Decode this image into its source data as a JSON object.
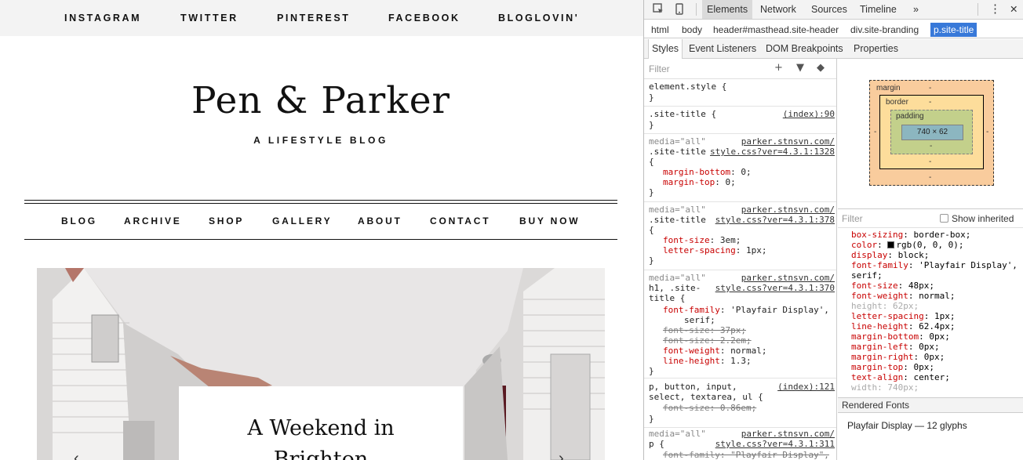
{
  "site": {
    "social": [
      "INSTAGRAM",
      "TWITTER",
      "PINTEREST",
      "FACEBOOK",
      "BLOGLOVIN'"
    ],
    "title": "Pen & Parker",
    "tagline": "A LIFESTYLE BLOG",
    "nav": [
      "BLOG",
      "ARCHIVE",
      "SHOP",
      "GALLERY",
      "ABOUT",
      "CONTACT",
      "BUY NOW"
    ],
    "featured_post": {
      "title_line1": "A Weekend in",
      "title_line2": "Brighton"
    },
    "slider": {
      "prev": "‹",
      "next": "›"
    }
  },
  "devtools": {
    "toolbar": {
      "inspect_icon": "inspect-icon",
      "device_icon": "device-icon",
      "more": "»",
      "menu": "⋮",
      "close": "✕"
    },
    "tabs": [
      "Elements",
      "Network",
      "Sources",
      "Timeline"
    ],
    "active_tab": "Elements",
    "breadcrumbs": [
      "html",
      "body",
      "header#masthead.site-header",
      "div.site-branding",
      "p.site-title"
    ],
    "subtabs": [
      "Styles",
      "Event Listeners",
      "DOM Breakpoints",
      "Properties"
    ],
    "styles_filter_placeholder": "Filter",
    "style_rules": {
      "r0": {
        "l1": "element.style {",
        "l2": "}"
      },
      "r1": {
        "selector": ".site-title {",
        "src": "(index):90",
        "close": "}"
      },
      "r2": {
        "media": "media=\"all\"",
        "src_a": "parker.stnsvn.com/",
        "selector": ".site-title",
        "src_b": "style.css?ver=4.3.1:1328",
        "open": "{",
        "p1n": "margin-bottom",
        "p1v": ": 0;",
        "p2n": "margin-top",
        "p2v": ": 0;",
        "close": "}"
      },
      "r3": {
        "media": "media=\"all\"",
        "src_a": "parker.stnsvn.com/",
        "selector": ".site-title",
        "src_b": "style.css?ver=4.3.1:378",
        "open": "{",
        "p1n": "font-size",
        "p1v": ": 3em;",
        "p2n": "letter-spacing",
        "p2v": ": 1px;",
        "close": "}"
      },
      "r4": {
        "media": "media=\"all\"",
        "src_a": "parker.stnsvn.com/",
        "sel1": "h1, .site-",
        "src_b": "style.css?ver=4.3.1:370",
        "sel2": "title {",
        "p1n": "font-family",
        "p1v": ": 'Playfair Display',",
        "p1v2": "serif;",
        "p2n": "font-size",
        "p2v": ": 37px;",
        "p3n": "font-size",
        "p3v": ": 2.2em;",
        "p4n": "font-weight",
        "p4v": ": normal;",
        "p5n": "line-height",
        "p5v": ": 1.3;",
        "close": "}"
      },
      "r5": {
        "sel1": "p, button, input,",
        "src": "(index):121",
        "sel2": "select, textarea, ul {",
        "p1n": "font-size",
        "p1v": ": 0.86em;",
        "close": "}"
      },
      "r6": {
        "media": "media=\"all\"",
        "src_a": "parker.stnsvn.com/",
        "sel": "p {",
        "src_b": "style.css?ver=4.3.1:311",
        "p1n": "font-family",
        "p1v": ": \"Playfair Display\","
      }
    },
    "box_model": {
      "margin": "margin",
      "border": "border",
      "padding": "padding",
      "content": "740 × 62",
      "dash": "-"
    },
    "computed_filter_placeholder": "Filter",
    "show_inherited": "Show inherited",
    "computed": [
      {
        "n": "box-sizing",
        "v": ": border-box;"
      },
      {
        "n": "color",
        "v": "rgb(0, 0, 0);",
        "swatch": "#000000"
      },
      {
        "n": "display",
        "v": ": block;"
      },
      {
        "n": "font-family",
        "v": ": 'Playfair Display',",
        "v2": "serif;"
      },
      {
        "n": "font-size",
        "v": ": 48px;"
      },
      {
        "n": "font-weight",
        "v": ": normal;"
      },
      {
        "n": "height",
        "v": ": 62px;",
        "dim": true
      },
      {
        "n": "letter-spacing",
        "v": ": 1px;"
      },
      {
        "n": "line-height",
        "v": ": 62.4px;"
      },
      {
        "n": "margin-bottom",
        "v": ": 0px;"
      },
      {
        "n": "margin-left",
        "v": ": 0px;"
      },
      {
        "n": "margin-right",
        "v": ": 0px;"
      },
      {
        "n": "margin-top",
        "v": ": 0px;"
      },
      {
        "n": "text-align",
        "v": ": center;"
      },
      {
        "n": "width",
        "v": ": 740px;",
        "dim": true
      }
    ],
    "rendered_fonts_header": "Rendered Fonts",
    "rendered_font": "Playfair Display — 12 glyphs"
  }
}
